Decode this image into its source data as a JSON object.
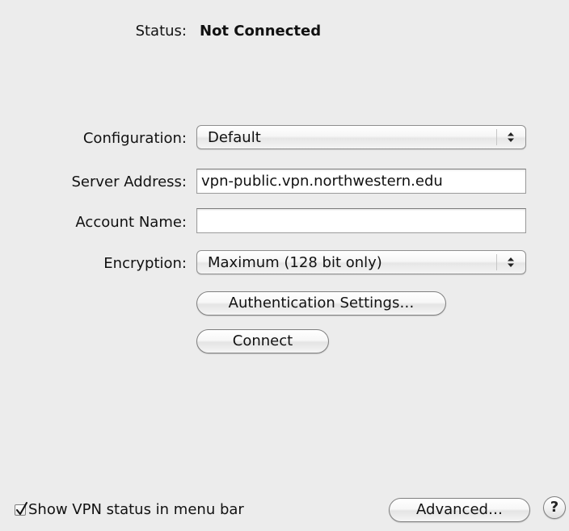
{
  "status": {
    "label": "Status:",
    "value": "Not Connected"
  },
  "form": {
    "configuration": {
      "label": "Configuration:",
      "selected": "Default"
    },
    "server_address": {
      "label": "Server Address:",
      "value": "vpn-public.vpn.northwestern.edu"
    },
    "account_name": {
      "label": "Account Name:",
      "value": ""
    },
    "encryption": {
      "label": "Encryption:",
      "selected": "Maximum (128 bit only)"
    }
  },
  "buttons": {
    "authentication_settings": "Authentication Settings…",
    "connect": "Connect",
    "advanced": "Advanced…",
    "help": "?"
  },
  "footer": {
    "show_status_checkbox": {
      "label": "Show VPN status in menu bar",
      "checked": true
    }
  },
  "icons": {
    "popup_arrows": "updown-arrows-icon",
    "checkmark": "checkmark-icon"
  }
}
